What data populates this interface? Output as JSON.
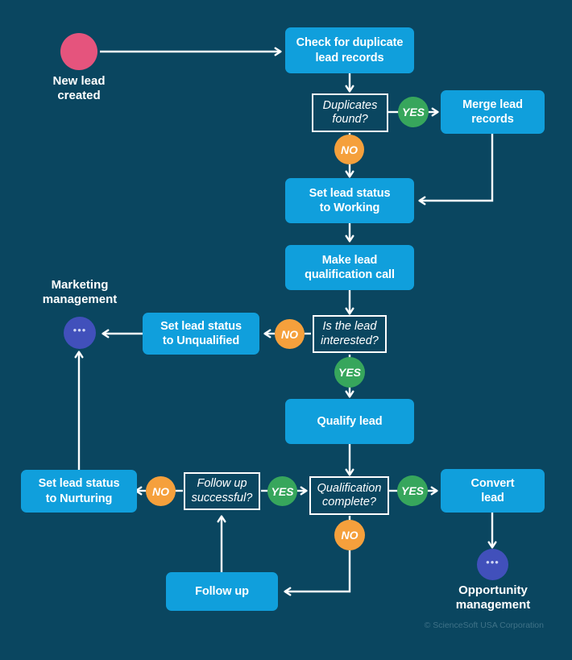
{
  "diagram": {
    "title": "Lead management process flowchart",
    "background_color": "#0a4660",
    "credit": "© ScienceSoft USA Corporation"
  },
  "colors": {
    "process": "#109fdc",
    "start_dot": "#e5547d",
    "end_dot": "#4150bb",
    "yes_badge": "#37a65c",
    "no_badge": "#f5a03c",
    "connector": "#ffffff",
    "decision_border": "#ffffff"
  },
  "captions": {
    "new_lead_created": "New lead\ncreated",
    "marketing_management": "Marketing\nmanagement",
    "opportunity_management": "Opportunity\nmanagement"
  },
  "nodes": {
    "start": {
      "type": "start",
      "label": ""
    },
    "check_duplicates": {
      "type": "process",
      "label": "Check for duplicate lead records"
    },
    "duplicates_found": {
      "type": "decision",
      "label": "Duplicates found?"
    },
    "merge_records": {
      "type": "process",
      "label": "Merge lead records"
    },
    "set_status_working": {
      "type": "process",
      "label": "Set lead status to Working"
    },
    "qualification_call": {
      "type": "process",
      "label": "Make lead qualification call"
    },
    "lead_interested": {
      "type": "decision",
      "label": "Is the lead interested?"
    },
    "set_status_unqualified": {
      "type": "process",
      "label": "Set lead status to Unqualified"
    },
    "marketing_end": {
      "type": "end",
      "label": "..."
    },
    "qualify_lead": {
      "type": "process",
      "label": "Qualify lead"
    },
    "qualification_complete": {
      "type": "decision",
      "label": "Qualification complete?"
    },
    "convert_lead": {
      "type": "process",
      "label": "Convert lead"
    },
    "opportunity_end": {
      "type": "end",
      "label": "..."
    },
    "follow_up_successful": {
      "type": "decision",
      "label": "Follow up successful?"
    },
    "set_status_nurturing": {
      "type": "process",
      "label": "Set lead status to Nurturing"
    },
    "follow_up": {
      "type": "process",
      "label": "Follow up"
    }
  },
  "node_text": {
    "check_duplicates_l1": "Check for duplicate",
    "check_duplicates_l2": "lead records",
    "duplicates_found_l1": "Duplicates",
    "duplicates_found_l2": "found?",
    "merge_records_l1": "Merge lead",
    "merge_records_l2": "records",
    "set_status_working_l1": "Set lead status",
    "set_status_working_l2": "to Working",
    "qualification_call_l1": "Make lead",
    "qualification_call_l2": "qualification call",
    "lead_interested_l1": "Is the lead",
    "lead_interested_l2": "interested?",
    "set_status_unqualified_l1": "Set lead status",
    "set_status_unqualified_l2": "to Unqualified",
    "qualify_lead_l1": "Qualify lead",
    "qualification_complete_l1": "Qualification",
    "qualification_complete_l2": "complete?",
    "convert_lead_l1": "Convert",
    "convert_lead_l2": "lead",
    "follow_up_successful_l1": "Follow up",
    "follow_up_successful_l2": "successful?",
    "set_status_nurturing_l1": "Set lead status",
    "set_status_nurturing_l2": "to Nurturing",
    "follow_up_l1": "Follow up",
    "marketing_caption_l1": "Marketing",
    "marketing_caption_l2": "management",
    "new_lead_caption_l1": "New lead",
    "new_lead_caption_l2": "created",
    "opportunity_caption_l1": "Opportunity",
    "opportunity_caption_l2": "management",
    "ellipsis": "•••"
  },
  "badges": {
    "duplicates_yes": "YES",
    "duplicates_no": "NO",
    "interested_no": "NO",
    "interested_yes": "YES",
    "followup_no": "NO",
    "followup_yes": "YES",
    "qualification_yes": "YES",
    "qualification_no": "NO"
  },
  "edges": [
    {
      "from": "start",
      "to": "check_duplicates",
      "label": ""
    },
    {
      "from": "check_duplicates",
      "to": "duplicates_found",
      "label": ""
    },
    {
      "from": "duplicates_found",
      "to": "merge_records",
      "label": "YES"
    },
    {
      "from": "duplicates_found",
      "to": "set_status_working",
      "label": "NO"
    },
    {
      "from": "merge_records",
      "to": "set_status_working",
      "label": ""
    },
    {
      "from": "set_status_working",
      "to": "qualification_call",
      "label": ""
    },
    {
      "from": "qualification_call",
      "to": "lead_interested",
      "label": ""
    },
    {
      "from": "lead_interested",
      "to": "set_status_unqualified",
      "label": "NO"
    },
    {
      "from": "set_status_unqualified",
      "to": "marketing_end",
      "label": ""
    },
    {
      "from": "lead_interested",
      "to": "qualify_lead",
      "label": "YES"
    },
    {
      "from": "qualify_lead",
      "to": "qualification_complete",
      "label": ""
    },
    {
      "from": "qualification_complete",
      "to": "convert_lead",
      "label": "YES"
    },
    {
      "from": "convert_lead",
      "to": "opportunity_end",
      "label": ""
    },
    {
      "from": "qualification_complete",
      "to": "follow_up",
      "label": "NO"
    },
    {
      "from": "follow_up",
      "to": "follow_up_successful",
      "label": ""
    },
    {
      "from": "follow_up_successful",
      "to": "qualification_complete",
      "label": "YES"
    },
    {
      "from": "follow_up_successful",
      "to": "set_status_nurturing",
      "label": "NO"
    },
    {
      "from": "set_status_nurturing",
      "to": "marketing_end",
      "label": ""
    }
  ]
}
